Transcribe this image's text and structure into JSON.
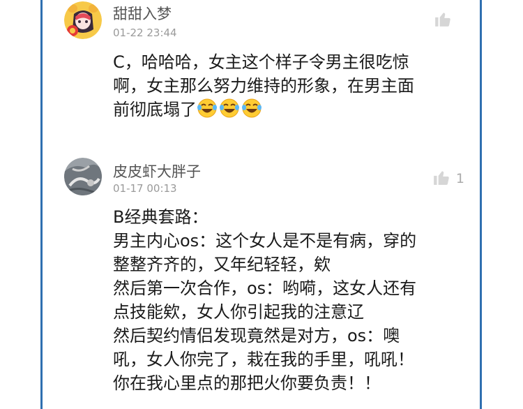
{
  "comments": [
    {
      "username": "甜甜入梦",
      "timestamp": "01-22 23:44",
      "like_count": "",
      "lines": [
        "C，哈哈哈，女主这个样子令男主很吃惊",
        "啊，女主那么努力维持的形象，在男主面",
        "前彻底塌了"
      ],
      "trailing_emoji": [
        "laughing-tears-emoji",
        "laughing-tears-emoji",
        "laughing-tears-emoji"
      ]
    },
    {
      "username": "皮皮虾大胖子",
      "timestamp": "01-17 00:13",
      "like_count": "1",
      "lines": [
        "B经典套路：",
        "男主内心os：这个女人是不是有病，穿的",
        "整整齐齐的，又年纪轻轻，欸",
        "然后第一次合作，os：哟嗬，这女人还有",
        "点技能欸，女人你引起我的注意辽",
        "然后契约情侣发现竟然是对方，os：噢",
        "吼，女人你完了，栽在我的手里，吼吼！",
        "你在我心里点的那把火你要负责！！"
      ]
    }
  ],
  "colors": {
    "frame": "#2f6fb0",
    "username": "#555555",
    "timestamp": "#9a9a9a",
    "like_icon": "#d6d6d6"
  },
  "icons": [
    "thumbs-up-icon",
    "avatar"
  ]
}
